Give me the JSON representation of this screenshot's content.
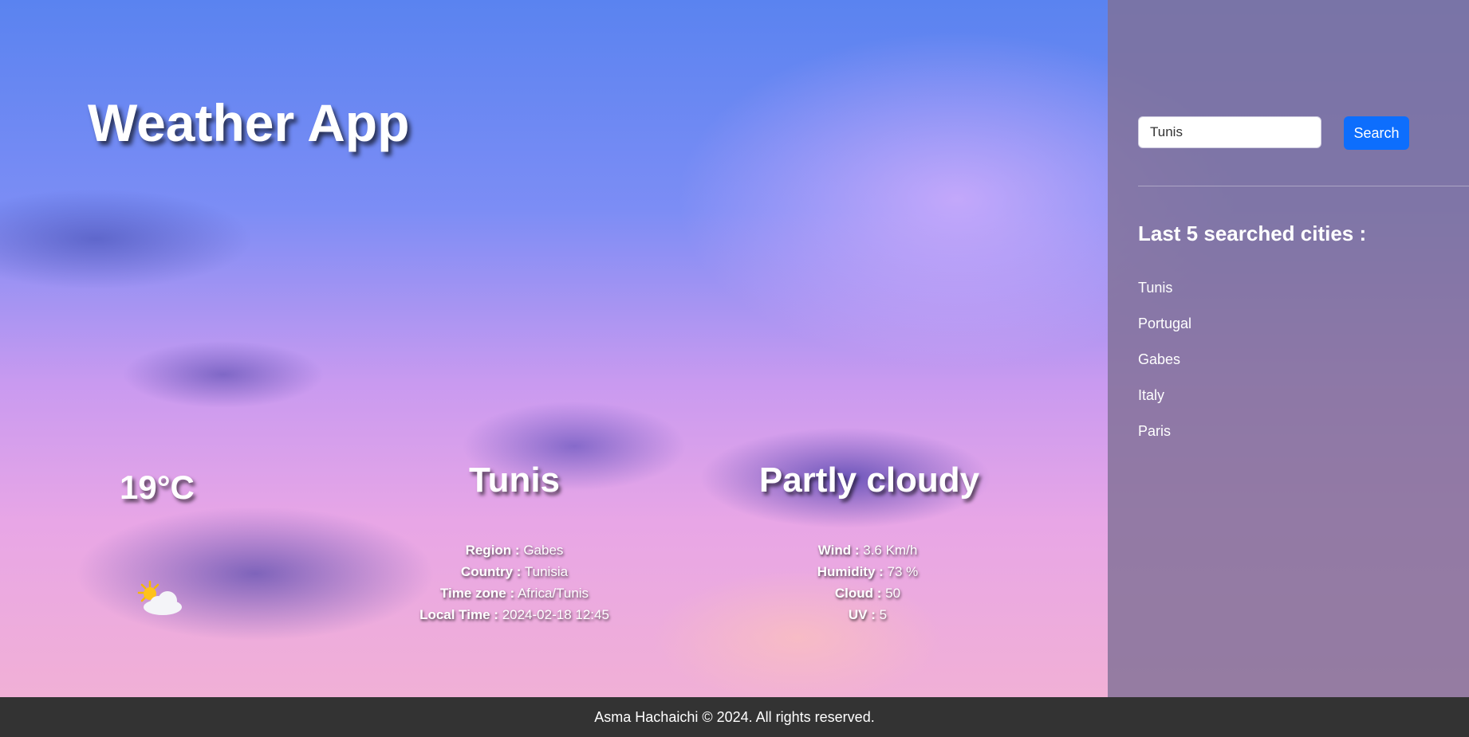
{
  "app": {
    "title": "Weather App"
  },
  "current": {
    "temperature": "19°C",
    "city": "Tunis",
    "condition": "Partly cloudy",
    "icon": "partly-cloudy-icon"
  },
  "location": [
    {
      "label": "Region :",
      "value": "Gabes"
    },
    {
      "label": "Country :",
      "value": "Tunisia"
    },
    {
      "label": "Time zone :",
      "value": "Africa/Tunis"
    },
    {
      "label": "Local Time :",
      "value": "2024-02-18 12:45"
    }
  ],
  "metrics": [
    {
      "label": "Wind :",
      "value": "3.6 Km/h"
    },
    {
      "label": "Humidity :",
      "value": "73 %"
    },
    {
      "label": "Cloud :",
      "value": "50"
    },
    {
      "label": "UV :",
      "value": "5"
    }
  ],
  "search": {
    "value": "Tunis",
    "button_label": "Search"
  },
  "recent": {
    "title": "Last 5 searched cities :",
    "cities": [
      "Tunis",
      "Portugal",
      "Gabes",
      "Italy",
      "Paris"
    ]
  },
  "footer": {
    "text": "Asma Hachaichi © 2024. All rights reserved."
  },
  "colors": {
    "accent": "#0d6efd",
    "footer_bg": "#333333"
  }
}
